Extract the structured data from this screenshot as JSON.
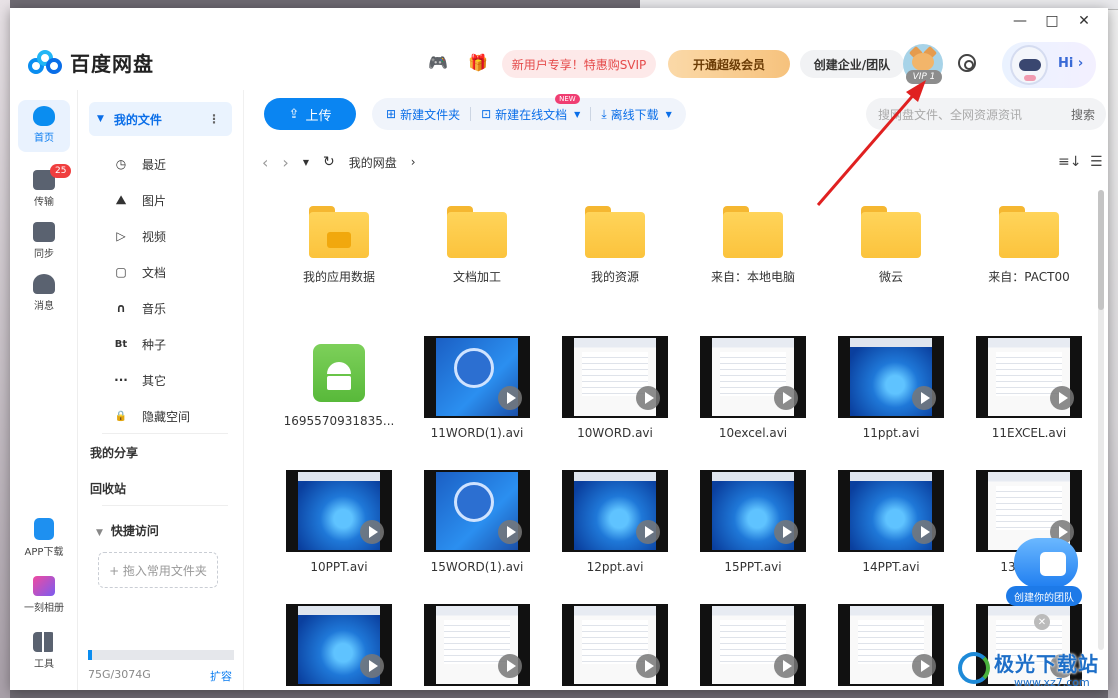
{
  "window": {
    "app_name": "百度网盘",
    "controls": [
      "—",
      "□",
      "✕"
    ]
  },
  "header": {
    "promo_label": "新用户专享！特惠购SVIP",
    "vip_button": "开通超级会员",
    "team_button": "创建企业/团队",
    "vip_tag": "VIP 1",
    "greeting": "Hi ›"
  },
  "rail": {
    "items": [
      {
        "label": "首页",
        "icon": "home-icon"
      },
      {
        "label": "传输",
        "icon": "transfer-icon",
        "badge": "25"
      },
      {
        "label": "同步",
        "icon": "sync-icon"
      },
      {
        "label": "消息",
        "icon": "message-icon"
      },
      {
        "label": "APP下载",
        "icon": "phone-icon"
      },
      {
        "label": "一刻相册",
        "icon": "album-icon"
      },
      {
        "label": "工具",
        "icon": "tools-icon"
      }
    ]
  },
  "sidenav": {
    "my_files": "我的文件",
    "items": [
      {
        "label": "最近",
        "glyph": "◷"
      },
      {
        "label": "图片",
        "glyph": "⛰"
      },
      {
        "label": "视频",
        "glyph": "▷"
      },
      {
        "label": "文档",
        "glyph": "▢"
      },
      {
        "label": "音乐",
        "glyph": "∩"
      },
      {
        "label": "种子",
        "glyph": "Bt"
      },
      {
        "label": "其它",
        "glyph": "···"
      },
      {
        "label": "隐藏空间",
        "glyph": "🔒"
      }
    ],
    "my_share": "我的分享",
    "recycle": "回收站",
    "quick_access": "快捷访问",
    "drop_hint": "+ 拖入常用文件夹",
    "quota_used_fraction": 0.024,
    "quota_text": "75G/3074G",
    "expand_label": "扩容"
  },
  "toolbar": {
    "upload": "上传",
    "new_folder": "新建文件夹",
    "new_online_doc": "新建在线文档",
    "new_tag": "NEW",
    "offline_download": "离线下载",
    "search_placeholder": "搜网盘文件、全网资源资讯",
    "search_button": "搜索"
  },
  "path": {
    "root": "我的网盘",
    "chevron": "›"
  },
  "files": [
    {
      "name": "我的应用数据",
      "kind": "folder-app"
    },
    {
      "name": "文档加工",
      "kind": "folder"
    },
    {
      "name": "我的资源",
      "kind": "folder"
    },
    {
      "name": "来自：本地电脑",
      "kind": "folder"
    },
    {
      "name": "微云",
      "kind": "folder"
    },
    {
      "name": "来自：PACT00",
      "kind": "folder"
    },
    {
      "name": "1695570931835...",
      "kind": "apk"
    },
    {
      "name": "11WORD(1).avi",
      "kind": "video-blue"
    },
    {
      "name": "10WORD.avi",
      "kind": "video-white"
    },
    {
      "name": "10excel.avi",
      "kind": "video-white"
    },
    {
      "name": "11ppt.avi",
      "kind": "video-win"
    },
    {
      "name": "11EXCEL.avi",
      "kind": "video-white"
    },
    {
      "name": "10PPT.avi",
      "kind": "video-win"
    },
    {
      "name": "15WORD(1).avi",
      "kind": "video-blue"
    },
    {
      "name": "12ppt.avi",
      "kind": "video-win"
    },
    {
      "name": "15PPT.avi",
      "kind": "video-win"
    },
    {
      "name": "14PPT.avi",
      "kind": "video-win"
    },
    {
      "name": "13PPT.avi",
      "kind": "video-white"
    },
    {
      "name": "",
      "kind": "video-win"
    },
    {
      "name": "",
      "kind": "video-white"
    },
    {
      "name": "",
      "kind": "video-white"
    },
    {
      "name": "",
      "kind": "video-white"
    },
    {
      "name": "",
      "kind": "video-white"
    },
    {
      "name": "",
      "kind": "video-white"
    }
  ],
  "float_widget": {
    "label": "创建你的团队"
  },
  "watermark": {
    "text": "极光下载站",
    "url": "www.xz7.com"
  }
}
